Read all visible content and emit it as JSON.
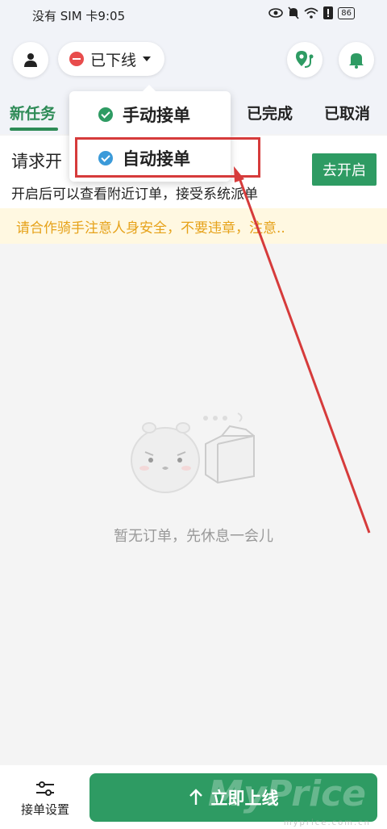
{
  "statusbar": {
    "left": "没有 SIM 卡9:05",
    "battery": "86"
  },
  "header": {
    "status_label": "已下线"
  },
  "tabs": [
    {
      "label": "新任务",
      "active": true
    },
    {
      "label": "已完成",
      "active": false
    },
    {
      "label": "已取消",
      "active": false
    }
  ],
  "notice": {
    "title": "请求开",
    "desc": "开启后可以查看附近订单，接受系统派单",
    "button": "去开启"
  },
  "marquee": "请合作骑手注意人身安全，不要违章，注意..",
  "empty": {
    "text": "暂无订单，先休息一会儿"
  },
  "dropdown": {
    "items": [
      {
        "label": "手动接单",
        "check_color": "#2e9b63"
      },
      {
        "label": "自动接单",
        "check_color": "#3b9ad9"
      }
    ]
  },
  "bottom": {
    "settings_label": "接单设置",
    "online_label": "立即上线"
  },
  "watermark": {
    "main": "MyPrice",
    "sub": "myprice.com.cn"
  },
  "colors": {
    "primary": "#2e9b63",
    "annotation": "#d63b3b",
    "warning": "#e6a21a"
  }
}
